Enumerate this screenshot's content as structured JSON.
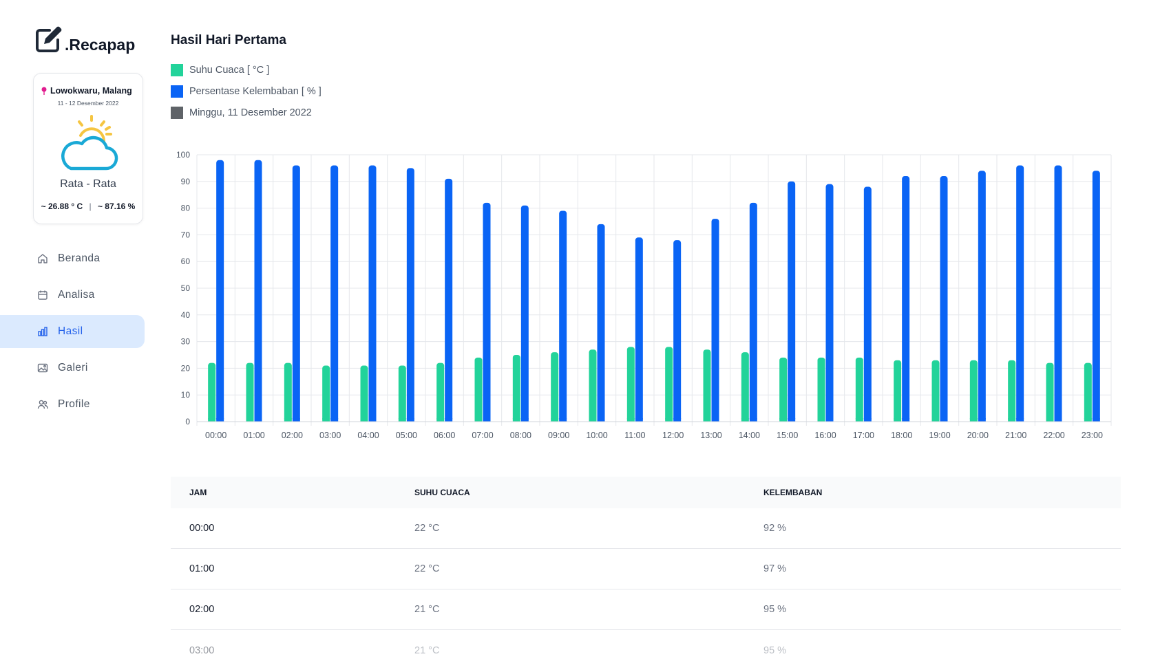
{
  "brand": {
    "name": ".Recapap"
  },
  "weather_card": {
    "location": "Lowokwaru, Malang",
    "date_range": "11 - 12 Desember 2022",
    "avg_label": "Rata - Rata",
    "avg_temp": "~ 26.88 ° C",
    "separator": "|",
    "avg_humidity": "~ 87.16 %"
  },
  "nav": {
    "items": [
      {
        "label": "Beranda",
        "icon": "home-icon",
        "active": false
      },
      {
        "label": "Analisa",
        "icon": "calendar-icon",
        "active": false
      },
      {
        "label": "Hasil",
        "icon": "bar-chart-icon",
        "active": true
      },
      {
        "label": "Galeri",
        "icon": "image-icon",
        "active": false
      },
      {
        "label": "Profile",
        "icon": "users-icon",
        "active": false
      }
    ]
  },
  "main": {
    "title": "Hasil Hari Pertama",
    "legend": [
      {
        "label": "Suhu Cuaca [ °C ]",
        "color": "#22d39a"
      },
      {
        "label": "Persentase Kelembaban [ % ]",
        "color": "#0a64f5"
      },
      {
        "label": "Minggu, 11 Desember 2022",
        "color": "#5f6368"
      }
    ]
  },
  "chart_data": {
    "type": "bar",
    "categories": [
      "00:00",
      "01:00",
      "02:00",
      "03:00",
      "04:00",
      "05:00",
      "06:00",
      "07:00",
      "08:00",
      "09:00",
      "10:00",
      "11:00",
      "12:00",
      "13:00",
      "14:00",
      "15:00",
      "16:00",
      "17:00",
      "18:00",
      "19:00",
      "20:00",
      "21:00",
      "22:00",
      "23:00"
    ],
    "series": [
      {
        "name": "Suhu Cuaca [ °C ]",
        "color": "#22d39a",
        "values": [
          22,
          22,
          22,
          21,
          21,
          21,
          22,
          24,
          25,
          26,
          27,
          28,
          28,
          27,
          26,
          24,
          24,
          24,
          23,
          23,
          23,
          23,
          22,
          22
        ]
      },
      {
        "name": "Persentase Kelembaban [ % ]",
        "color": "#0a64f5",
        "values": [
          98,
          98,
          96,
          96,
          96,
          95,
          91,
          82,
          81,
          79,
          74,
          69,
          68,
          76,
          82,
          90,
          89,
          88,
          92,
          92,
          94,
          96,
          96,
          94
        ]
      }
    ],
    "ylim": [
      0,
      100
    ],
    "yticks": [
      0,
      10,
      20,
      30,
      40,
      50,
      60,
      70,
      80,
      90,
      100
    ],
    "grid": true
  },
  "table": {
    "headers": [
      "JAM",
      "SUHU CUACA",
      "KELEMBABAN"
    ],
    "rows": [
      [
        "00:00",
        "22 °C",
        "92 %"
      ],
      [
        "01:00",
        "22 °C",
        "97 %"
      ],
      [
        "02:00",
        "21 °C",
        "95 %"
      ],
      [
        "03:00",
        "21 °C",
        "95 %"
      ]
    ]
  }
}
